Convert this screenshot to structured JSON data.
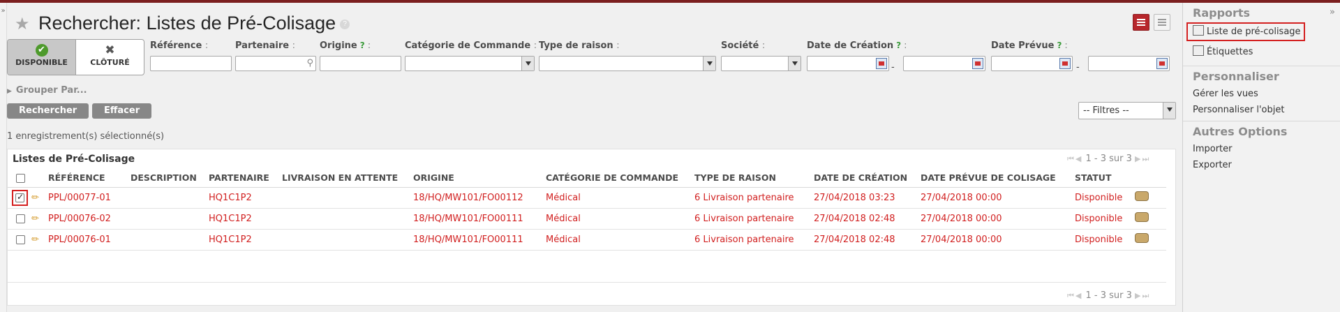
{
  "page_title": "Rechercher: Listes de Pré-Colisage",
  "help_marker": "?",
  "toggle_left": "»",
  "toggle_right": "»",
  "filters": {
    "active": {
      "label": "DISPONIBLE",
      "icon": "check-circle-icon"
    },
    "inactive": {
      "label": "CLÔTURÉ",
      "icon": "close-icon"
    }
  },
  "search_fields": {
    "reference": "Référence",
    "partenaire": "Partenaire",
    "origine": "Origine",
    "categorie": "Catégorie de Commande",
    "type_raison": "Type de raison",
    "societe": "Société",
    "date_creation": "Date de Création",
    "date_prevue": "Date Prévue",
    "colon": ":",
    "help": "?",
    "range_sep": "-"
  },
  "group_by": "Grouper Par...",
  "buttons": {
    "search": "Rechercher",
    "clear": "Effacer"
  },
  "filter_select": "-- Filtres --",
  "selection_count": "1 enregistrement(s) sélectionné(s)",
  "list": {
    "title": "Listes de Pré-Colisage",
    "pager": "1 - 3 sur 3",
    "columns": [
      "RÉFÉRENCE",
      "DESCRIPTION",
      "PARTENAIRE",
      "LIVRAISON EN ATTENTE",
      "ORIGINE",
      "CATÉGORIE DE COMMANDE",
      "TYPE DE RAISON",
      "DATE DE CRÉATION",
      "DATE PRÉVUE DE COLISAGE",
      "STATUT"
    ],
    "rows": [
      {
        "ref": "PPL/00077-01",
        "desc": "",
        "partner": "HQ1C1P2",
        "pending": "",
        "origin": "18/HQ/MW101/FO00112",
        "category": "Médical",
        "reason": "6 Livraison partenaire",
        "created": "27/04/2018 03:23",
        "planned": "27/04/2018 00:00",
        "status": "Disponible",
        "checked": true
      },
      {
        "ref": "PPL/00076-02",
        "desc": "",
        "partner": "HQ1C1P2",
        "pending": "",
        "origin": "18/HQ/MW101/FO00111",
        "category": "Médical",
        "reason": "6 Livraison partenaire",
        "created": "27/04/2018 02:48",
        "planned": "27/04/2018 00:00",
        "status": "Disponible",
        "checked": false
      },
      {
        "ref": "PPL/00076-01",
        "desc": "",
        "partner": "HQ1C1P2",
        "pending": "",
        "origin": "18/HQ/MW101/FO00111",
        "category": "Médical",
        "reason": "6 Livraison partenaire",
        "created": "27/04/2018 02:48",
        "planned": "27/04/2018 00:00",
        "status": "Disponible",
        "checked": false
      }
    ]
  },
  "sidebar": {
    "reports_title": "Rapports",
    "reports": [
      "Liste de pré-colisage",
      "Étiquettes"
    ],
    "customize_title": "Personnaliser",
    "customize": [
      "Gérer les vues",
      "Personnaliser l'objet"
    ],
    "other_title": "Autres Options",
    "other": [
      "Importer",
      "Exporter"
    ]
  },
  "colors": {
    "accent": "#b7262b",
    "row_text": "#d11f1f",
    "highlight": "#d42020"
  }
}
